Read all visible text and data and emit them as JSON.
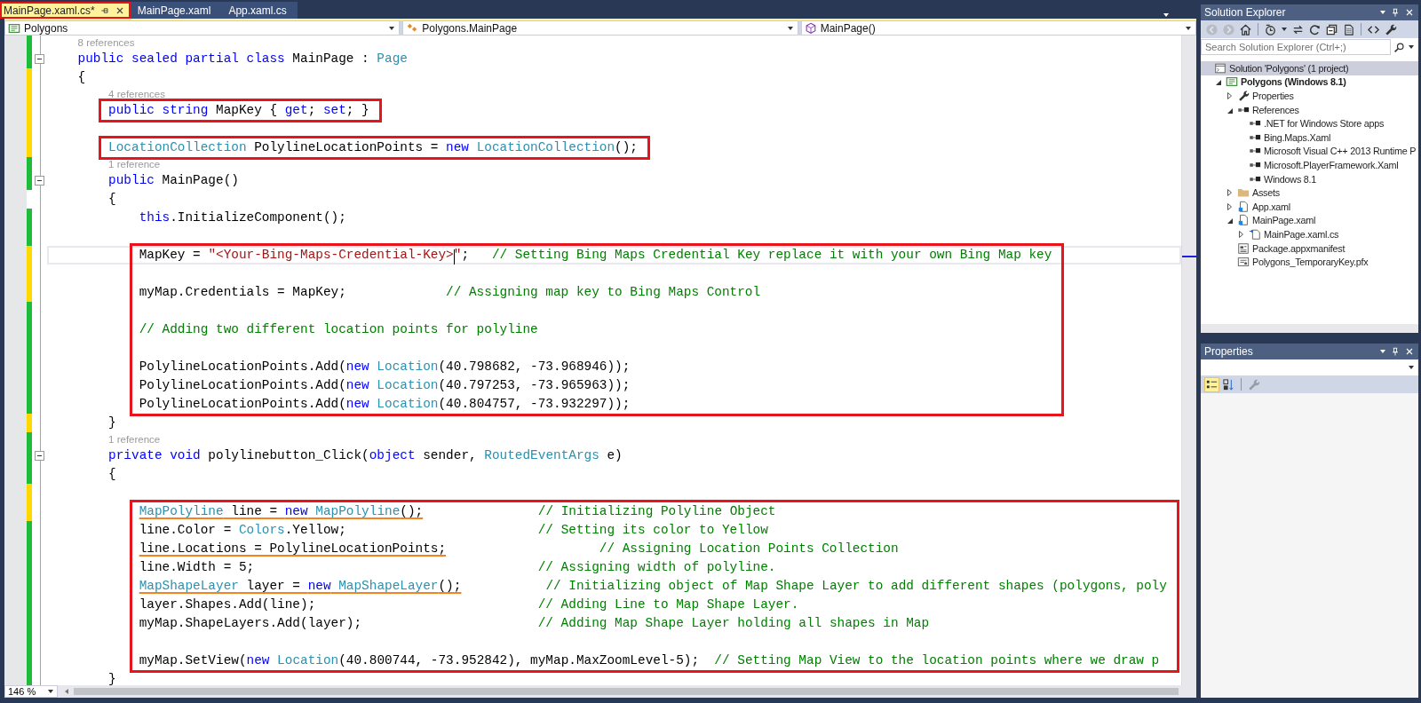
{
  "tabs": [
    {
      "label": "MainPage.xaml.cs*",
      "selected": true,
      "annotated": true
    },
    {
      "label": "MainPage.xaml",
      "selected": false,
      "annotated": false
    },
    {
      "label": "App.xaml.cs",
      "selected": false,
      "annotated": false
    }
  ],
  "navigation_bar": [
    {
      "kind": "project",
      "label": "Polygons"
    },
    {
      "kind": "class",
      "label": "Polygons.MainPage"
    },
    {
      "kind": "method",
      "label": "MainPage()"
    }
  ],
  "editor": {
    "lines": [
      {
        "kind": "lens",
        "text": "8 references",
        "saved": true
      },
      {
        "kind": "code",
        "saved": true,
        "fold": true,
        "tokens": [
          {
            "kind": "kw",
            "t": "    public sealed partial class"
          },
          {
            "kind": "plain",
            "t": " MainPage : "
          },
          {
            "kind": "type",
            "t": "Page"
          }
        ]
      },
      {
        "kind": "code",
        "saved": false,
        "tokens": [
          {
            "kind": "plain",
            "t": "    {"
          }
        ]
      },
      {
        "kind": "lens",
        "text": "4 references",
        "saved": false
      },
      {
        "kind": "box",
        "lines": [
          {
            "kind": "code",
            "saved": false,
            "tokens": [
              {
                "kind": "kw",
                "t": "        public string"
              },
              {
                "kind": "plain",
                "t": " MapKey { "
              },
              {
                "kind": "kw",
                "t": "get"
              },
              {
                "kind": "plain",
                "t": "; "
              },
              {
                "kind": "kw",
                "t": "set"
              },
              {
                "kind": "plain",
                "t": "; }"
              }
            ]
          }
        ]
      },
      {
        "kind": "blank",
        "saved": false
      },
      {
        "kind": "box",
        "lines": [
          {
            "kind": "code",
            "saved": false,
            "tokens": [
              {
                "kind": "type",
                "t": "        LocationCollection"
              },
              {
                "kind": "plain",
                "t": " PolylineLocationPoints = "
              },
              {
                "kind": "kw",
                "t": "new"
              },
              {
                "kind": "type",
                "t": " LocationCollection"
              },
              {
                "kind": "plain",
                "t": "();"
              }
            ]
          }
        ]
      },
      {
        "kind": "lens",
        "text": "1 reference",
        "saved": true
      },
      {
        "kind": "code",
        "saved": true,
        "fold": true,
        "tokens": [
          {
            "kind": "kw",
            "t": "        public"
          },
          {
            "kind": "plain",
            "t": " MainPage()"
          }
        ]
      },
      {
        "kind": "code",
        "tokens": [
          {
            "kind": "plain",
            "t": "        {"
          }
        ]
      },
      {
        "kind": "code",
        "saved": true,
        "tokens": [
          {
            "kind": "kw",
            "t": "            this"
          },
          {
            "kind": "plain",
            "t": ".InitializeComponent();"
          }
        ]
      },
      {
        "kind": "blank",
        "saved": true
      },
      {
        "kind": "box",
        "lines": [
          {
            "kind": "code",
            "saved": false,
            "current": true,
            "tokens": [
              {
                "kind": "plain",
                "t": "            MapKey = "
              },
              {
                "kind": "string",
                "t": "\"<Your-Bing-Maps-Credential-Key>",
                "cursor": true
              },
              {
                "kind": "string",
                "t": "\""
              },
              {
                "kind": "plain",
                "t": ";"
              },
              {
                "kind": "comment",
                "t": "   // Setting Bing Maps Credential Key replace it with your own Bing Map key"
              }
            ]
          },
          {
            "kind": "blank",
            "saved": false
          },
          {
            "kind": "code",
            "saved": false,
            "tokens": [
              {
                "kind": "plain",
                "t": "            myMap.Credentials = MapKey;"
              },
              {
                "kind": "comment",
                "t": "             // Assigning map key to Bing Maps Control"
              }
            ]
          },
          {
            "kind": "blank",
            "saved": true
          },
          {
            "kind": "code",
            "saved": true,
            "tokens": [
              {
                "kind": "comment",
                "t": "            // Adding two different location points for polyline"
              }
            ]
          },
          {
            "kind": "blank",
            "saved": true
          },
          {
            "kind": "code",
            "saved": true,
            "tokens": [
              {
                "kind": "plain",
                "t": "            PolylineLocationPoints.Add("
              },
              {
                "kind": "kw",
                "t": "new"
              },
              {
                "kind": "type",
                "t": " Location"
              },
              {
                "kind": "plain",
                "t": "(40.798682, -73.968946));"
              }
            ]
          },
          {
            "kind": "code",
            "saved": true,
            "tokens": [
              {
                "kind": "plain",
                "t": "            PolylineLocationPoints.Add("
              },
              {
                "kind": "kw",
                "t": "new"
              },
              {
                "kind": "type",
                "t": " Location"
              },
              {
                "kind": "plain",
                "t": "(40.797253, -73.965963));"
              }
            ]
          },
          {
            "kind": "code",
            "saved": true,
            "tokens": [
              {
                "kind": "plain",
                "t": "            PolylineLocationPoints.Add("
              },
              {
                "kind": "kw",
                "t": "new"
              },
              {
                "kind": "type",
                "t": " Location"
              },
              {
                "kind": "plain",
                "t": "(40.804757, -73.932297));"
              }
            ]
          }
        ]
      },
      {
        "kind": "code",
        "saved": false,
        "tokens": [
          {
            "kind": "plain",
            "t": "        }"
          }
        ]
      },
      {
        "kind": "lens",
        "text": "1 reference",
        "saved": true
      },
      {
        "kind": "code",
        "saved": true,
        "fold": true,
        "tokens": [
          {
            "kind": "kw",
            "t": "        private void"
          },
          {
            "kind": "plain",
            "t": " polylinebutton_Click("
          },
          {
            "kind": "kw",
            "t": "object"
          },
          {
            "kind": "plain",
            "t": " sender, "
          },
          {
            "kind": "type",
            "t": "RoutedEventArgs"
          },
          {
            "kind": "plain",
            "t": " e)"
          }
        ]
      },
      {
        "kind": "code",
        "saved": true,
        "tokens": [
          {
            "kind": "plain",
            "t": "        {"
          }
        ]
      },
      {
        "kind": "blank",
        "saved": false
      },
      {
        "kind": "box",
        "lines": [
          {
            "kind": "code",
            "saved": false,
            "underlined": true,
            "tokens": [
              {
                "kind": "type",
                "t": "            MapPolyline"
              },
              {
                "kind": "plain",
                "t": " line = "
              },
              {
                "kind": "kw",
                "t": "new"
              },
              {
                "kind": "type",
                "t": " MapPolyline"
              },
              {
                "kind": "plain",
                "t": "();"
              },
              {
                "kind": "comment",
                "t": "               // Initializing Polyline Object"
              }
            ]
          },
          {
            "kind": "code",
            "saved": true,
            "underlined": false,
            "tokens": [
              {
                "kind": "plain",
                "t": "            line.Color = "
              },
              {
                "kind": "type",
                "t": "Colors"
              },
              {
                "kind": "plain",
                "t": ".Yellow;"
              },
              {
                "kind": "comment",
                "t": "                         // Setting its color to Yellow"
              }
            ]
          },
          {
            "kind": "code",
            "saved": true,
            "underlined": true,
            "tokens": [
              {
                "kind": "plain",
                "t": "            line.Locations = PolylineLocationPoints;"
              },
              {
                "kind": "comment",
                "t": "                    // Assigning Location Points Collection"
              }
            ]
          },
          {
            "kind": "code",
            "saved": true,
            "underlined": false,
            "tokens": [
              {
                "kind": "plain",
                "t": "            line.Width = 5;"
              },
              {
                "kind": "comment",
                "t": "                                     // Assigning width of polyline."
              }
            ]
          },
          {
            "kind": "code",
            "saved": true,
            "underlined": true,
            "tokens": [
              {
                "kind": "type",
                "t": "            MapShapeLayer"
              },
              {
                "kind": "plain",
                "t": " layer = "
              },
              {
                "kind": "kw",
                "t": "new"
              },
              {
                "kind": "type",
                "t": " MapShapeLayer"
              },
              {
                "kind": "plain",
                "t": "();"
              },
              {
                "kind": "comment",
                "t": "           // Initializing object of Map Shape Layer to add different shapes (polygons, poly"
              }
            ]
          },
          {
            "kind": "code",
            "saved": true,
            "underlined": false,
            "tokens": [
              {
                "kind": "plain",
                "t": "            layer.Shapes.Add(line);"
              },
              {
                "kind": "comment",
                "t": "                             // Adding Line to Map Shape Layer."
              }
            ]
          },
          {
            "kind": "code",
            "saved": true,
            "underlined": false,
            "tokens": [
              {
                "kind": "plain",
                "t": "            myMap.ShapeLayers.Add(layer);"
              },
              {
                "kind": "comment",
                "t": "                       // Adding Map Shape Layer holding all shapes in Map"
              }
            ]
          },
          {
            "kind": "blank",
            "saved": true
          },
          {
            "kind": "code",
            "saved": true,
            "underlined": false,
            "tokens": [
              {
                "kind": "plain",
                "t": "            myMap.SetView("
              },
              {
                "kind": "kw",
                "t": "new"
              },
              {
                "kind": "type",
                "t": " Location"
              },
              {
                "kind": "plain",
                "t": "(40.800744, -73.952842), myMap.MaxZoomLevel-5);"
              },
              {
                "kind": "comment",
                "t": "  // Setting Map View to the location points where we draw p"
              }
            ]
          }
        ]
      },
      {
        "kind": "code",
        "saved": true,
        "tokens": [
          {
            "kind": "plain",
            "t": "        }"
          }
        ]
      }
    ],
    "zoom": "146 %"
  },
  "solution_explorer": {
    "title": "Solution Explorer",
    "toolbar": [
      {
        "kind": "back",
        "disabled": true
      },
      {
        "kind": "forward",
        "disabled": true
      },
      {
        "kind": "home",
        "disabled": false
      },
      {
        "kind": "history",
        "disabled": false
      },
      {
        "kind": "sync",
        "disabled": false
      },
      {
        "kind": "refresh",
        "disabled": false
      },
      {
        "kind": "collapse",
        "disabled": false
      },
      {
        "kind": "showall",
        "disabled": false
      },
      {
        "kind": "code",
        "disabled": false
      },
      {
        "kind": "wrench",
        "disabled": false
      }
    ],
    "search": {
      "placeholder": "Search Solution Explorer (Ctrl+;)"
    },
    "tree": [
      {
        "kind": "solution",
        "label": "Solution 'Polygons' (1 project)",
        "selected": true,
        "children": [
          {
            "kind": "csproject",
            "label": "Polygons (Windows 8.1)",
            "selected": false,
            "bold": true,
            "expanded": true,
            "children": [
              {
                "kind": "wrench",
                "label": "Properties",
                "selected": false,
                "expanded": false
              },
              {
                "kind": "references",
                "label": "References",
                "selected": false,
                "expanded": true,
                "children": [
                  {
                    "kind": "assembly",
                    "label": ".NET for Windows Store apps",
                    "selected": false
                  },
                  {
                    "kind": "assembly",
                    "label": "Bing.Maps.Xaml",
                    "selected": false
                  },
                  {
                    "kind": "assembly",
                    "label": "Microsoft Visual C++ 2013 Runtime P",
                    "selected": false
                  },
                  {
                    "kind": "assembly",
                    "label": "Microsoft.PlayerFramework.Xaml",
                    "selected": false
                  },
                  {
                    "kind": "assembly",
                    "label": "Windows 8.1",
                    "selected": false
                  }
                ]
              },
              {
                "kind": "folder",
                "label": "Assets",
                "selected": false,
                "expanded": false
              },
              {
                "kind": "xaml",
                "label": "App.xaml",
                "selected": false,
                "expanded": false
              },
              {
                "kind": "xaml",
                "label": "MainPage.xaml",
                "selected": false,
                "expanded": true,
                "children": [
                  {
                    "kind": "cs",
                    "label": "MainPage.xaml.cs",
                    "selected": false,
                    "expanded": false
                  }
                ]
              },
              {
                "kind": "manifest",
                "label": "Package.appxmanifest",
                "selected": false
              },
              {
                "kind": "certificate",
                "label": "Polygons_TemporaryKey.pfx",
                "selected": false
              }
            ]
          }
        ]
      }
    ]
  },
  "properties_panel": {
    "title": "Properties",
    "toolbar": [
      {
        "kind": "categorized",
        "selected": true,
        "disabled": false
      },
      {
        "kind": "alphabetical",
        "selected": false,
        "disabled": false
      },
      {
        "kind": "wrench",
        "selected": false,
        "disabled": true
      }
    ]
  }
}
